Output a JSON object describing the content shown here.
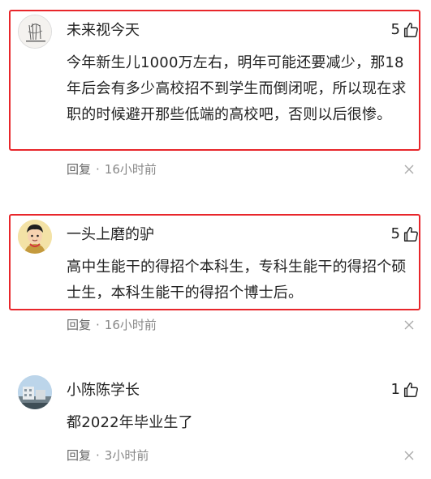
{
  "comments": [
    {
      "username": "未来视今天",
      "likes": "5",
      "text": "今年新生儿1000万左右，明年可能还要减少，那18年后会有多少高校招不到学生而倒闭呢，所以现在求职的时候避开那些低端的高校吧，否则以后很惨。",
      "reply_label": "回复",
      "time": "16小时前",
      "highlighted": true,
      "avatar": "sketch-avatar"
    },
    {
      "username": "一头上磨的驴",
      "likes": "5",
      "text": "高中生能干的得招个本科生，专科生能干的得招个硕士生，本科生能干的得招个博士后。",
      "reply_label": "回复",
      "time": "16小时前",
      "highlighted": true,
      "avatar": "cartoon-character-avatar"
    },
    {
      "username": "小陈陈学长",
      "likes": "1",
      "text": "都2022年毕业生了",
      "reply_label": "回复",
      "time": "3小时前",
      "highlighted": false,
      "avatar": "building-photo-avatar"
    }
  ],
  "icons": {
    "like": "thumbs-up-icon",
    "close": "close-icon"
  },
  "colors": {
    "highlight_border": "#e8262b",
    "meta_text": "#888888"
  }
}
